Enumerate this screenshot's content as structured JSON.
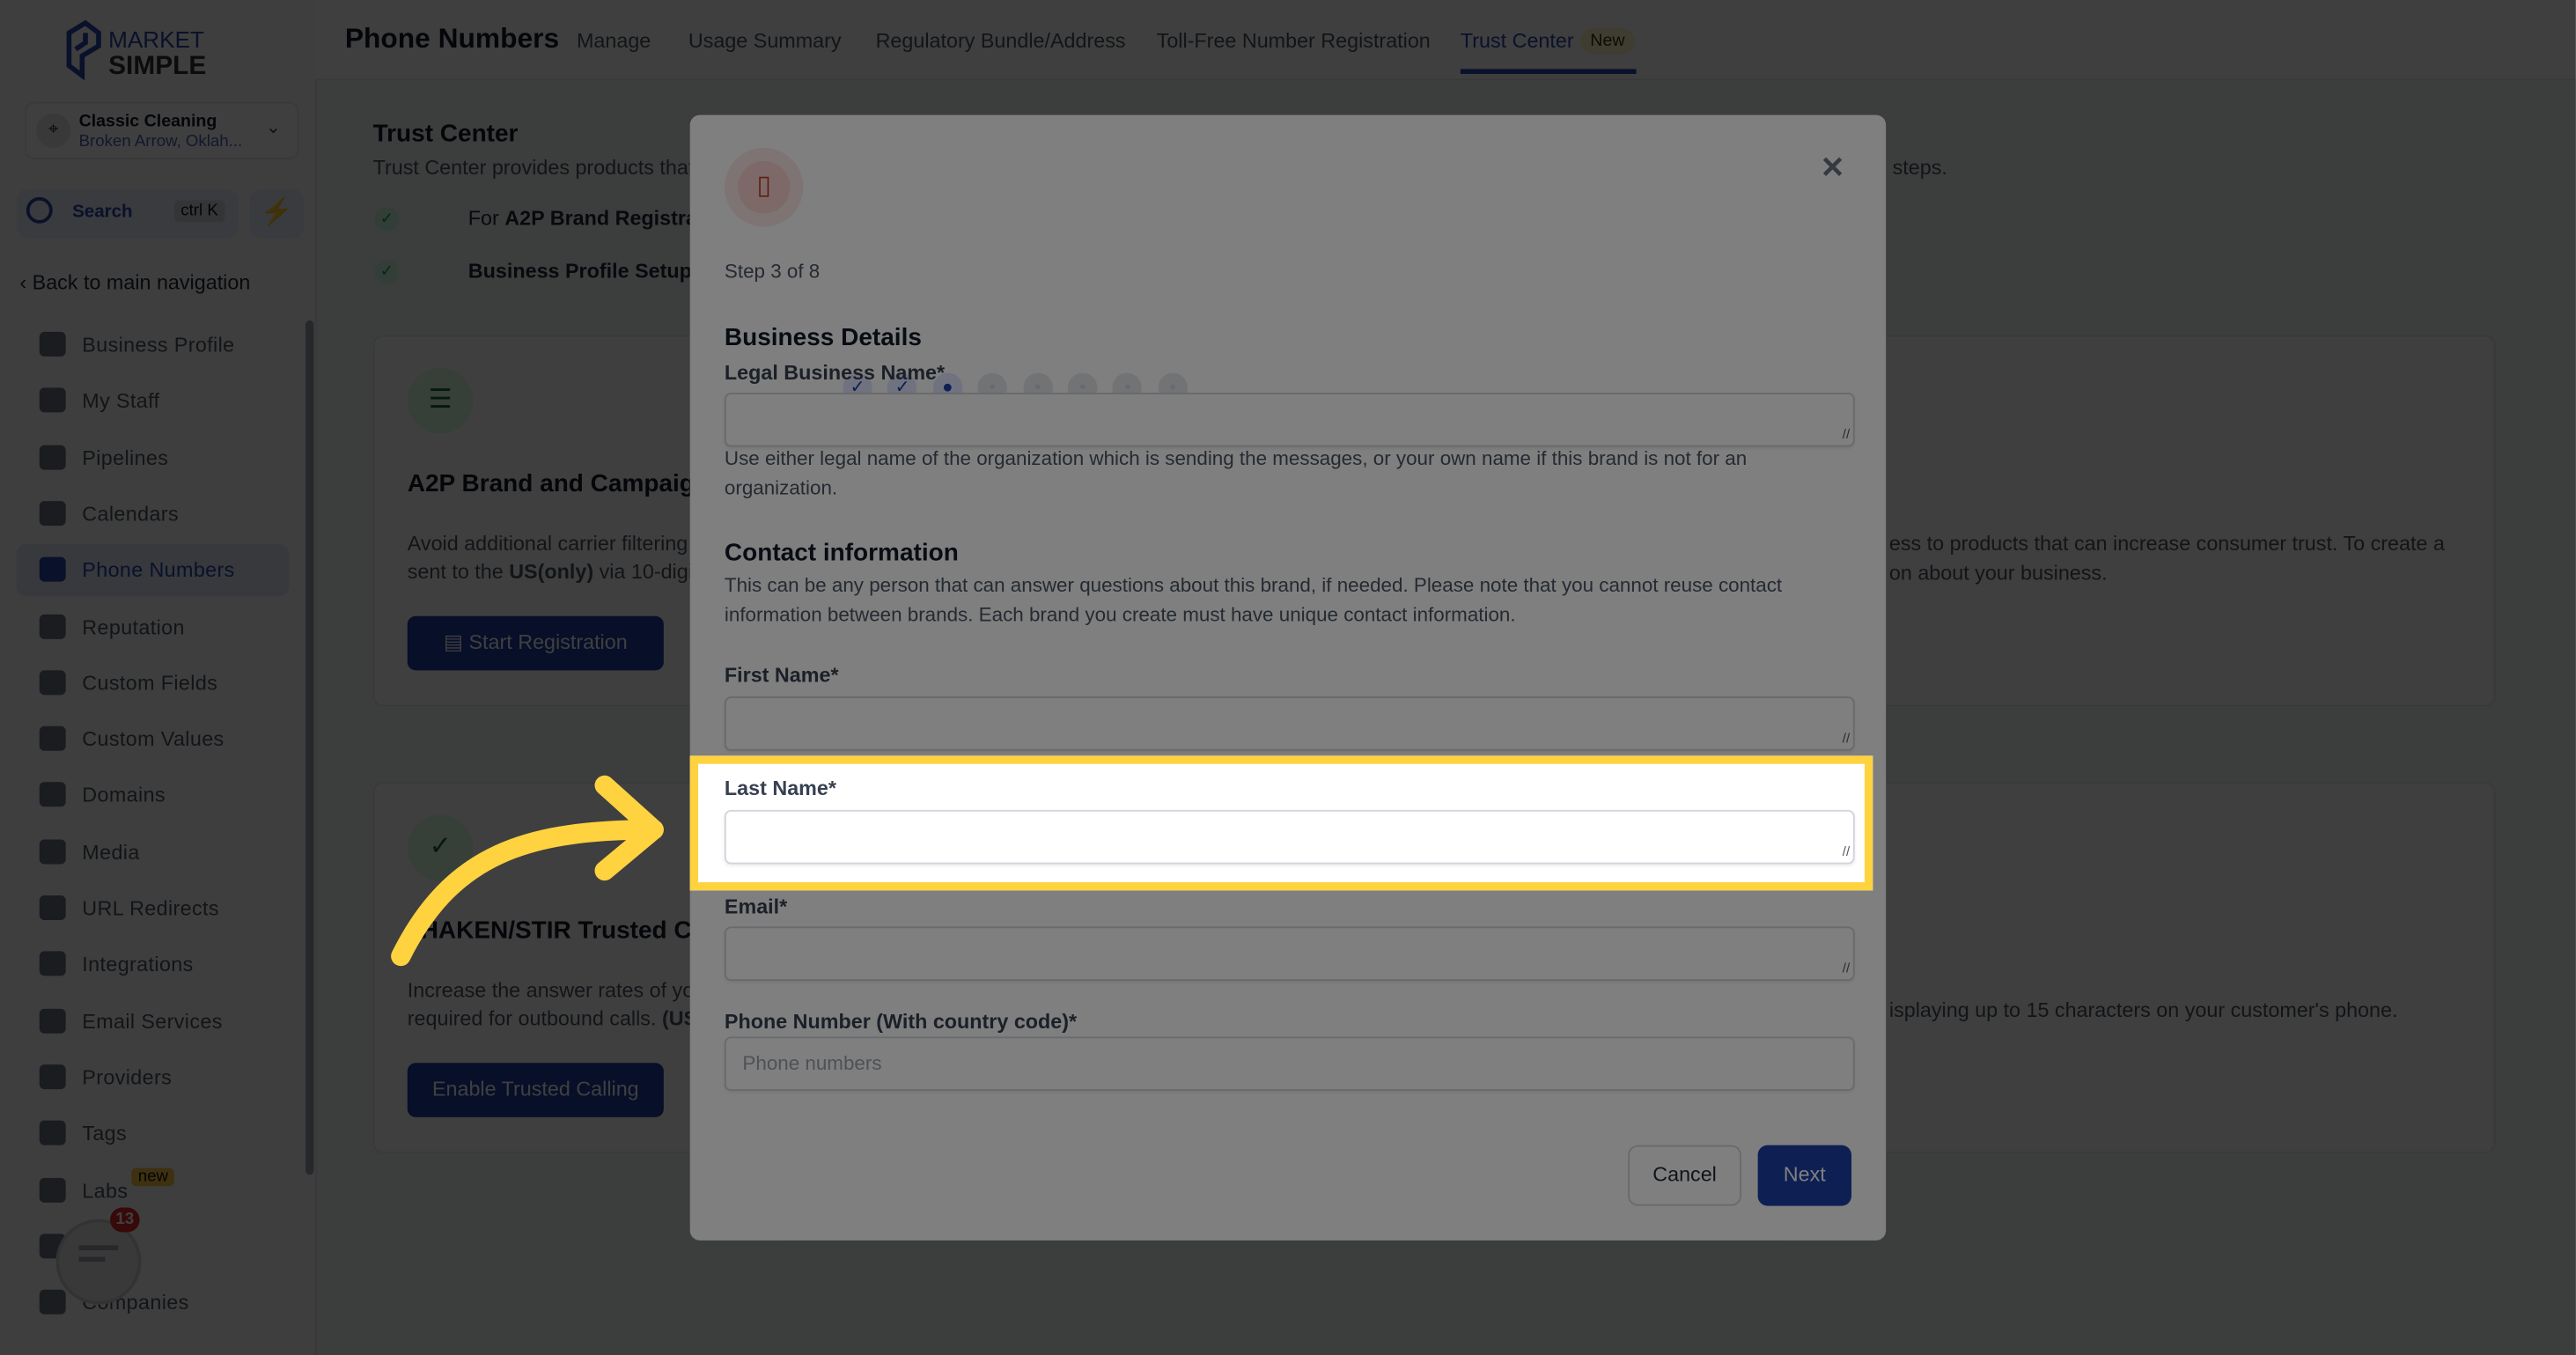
{
  "brand": {
    "logo_top": "MARKET",
    "logo_bottom": "SIMPLE"
  },
  "location": {
    "name": "Classic Cleaning",
    "address": "Broken Arrow, Oklah..."
  },
  "search": {
    "label": "Search",
    "shortcut": "ctrl K"
  },
  "sidebar": {
    "back": "Back to main navigation",
    "items": [
      {
        "label": "Business Profile",
        "icon": "briefcase-icon"
      },
      {
        "label": "My Staff",
        "icon": "user-icon"
      },
      {
        "label": "Pipelines",
        "icon": "funnel-icon"
      },
      {
        "label": "Calendars",
        "icon": "calendar-icon"
      },
      {
        "label": "Phone Numbers",
        "icon": "phone-icon",
        "active": true
      },
      {
        "label": "Reputation",
        "icon": "star-icon"
      },
      {
        "label": "Custom Fields",
        "icon": "fields-icon"
      },
      {
        "label": "Custom Values",
        "icon": "diamond-icon"
      },
      {
        "label": "Domains",
        "icon": "globe-icon"
      },
      {
        "label": "Media",
        "icon": "video-icon"
      },
      {
        "label": "URL Redirects",
        "icon": "redirect-icon"
      },
      {
        "label": "Integrations",
        "icon": "integrations-icon"
      },
      {
        "label": "Email Services",
        "icon": "mail-icon"
      },
      {
        "label": "Providers",
        "icon": "clipboard-icon"
      },
      {
        "label": "Tags",
        "icon": "tag-icon"
      },
      {
        "label": "Labs",
        "icon": "flask-icon"
      },
      {
        "label": "Logs",
        "icon": "bar-chart-icon"
      },
      {
        "label": "Companies",
        "icon": "building-icon"
      }
    ],
    "labs_badge": "new"
  },
  "chat": {
    "badge": "13"
  },
  "header": {
    "title": "Phone Numbers",
    "tabs": [
      {
        "label": "Manage"
      },
      {
        "label": "Usage Summary"
      },
      {
        "label": "Regulatory Bundle/Address"
      },
      {
        "label": "Toll-Free Number Registration"
      },
      {
        "label": "Trust Center",
        "active": true
      }
    ],
    "tab_badge": "New"
  },
  "content": {
    "title": "Trust Center",
    "desc": "Trust Center provides products that c",
    "desc_tail": "steps.",
    "checks": [
      {
        "prefix": "For ",
        "bold": "A2P Brand Registratio"
      },
      {
        "prefix": "",
        "bold": "Business Profile Setup",
        "suffix": " w"
      }
    ],
    "card1": {
      "title": "A2P Brand and Campaign",
      "line1": "Avoid additional carrier filtering b",
      "line2_pre": "sent to the ",
      "line2_bold": "US(only)",
      "line2_post": " via 10-digit l",
      "button": "Start Registration",
      "tail1": "ess to products that can increase consumer trust. To create a",
      "tail2": "on about your business."
    },
    "card2": {
      "title": "HAKEN/STIR Trusted Ca",
      "line1": "Increase the answer rates of you",
      "line2_pre": "required for outbound calls. ",
      "line2_bold": "(US",
      "button": "Enable Trusted Calling",
      "tail1": "isplaying up to 15 characters on your customer's phone."
    }
  },
  "modal": {
    "step": "Step 3 of 8",
    "steps_total": 8,
    "steps_done": 2,
    "step_current": 3,
    "business_heading": "Business Details",
    "legal_label": "Legal Business Name*",
    "legal_value": "",
    "legal_help": "Use either legal name of the organization which is sending the messages, or your own name if this brand is not for an organization.",
    "contact_heading": "Contact information",
    "contact_desc": "This can be any person that can answer questions about this brand, if needed. Please note that you cannot reuse contact information between brands. Each brand you create must have unique contact information.",
    "first_label": "First Name*",
    "first_value": "",
    "last_label": "Last Name*",
    "last_value": "",
    "email_label": "Email*",
    "email_value": "",
    "phone_label": "Phone Number (With country code)*",
    "phone_placeholder": "Phone numbers",
    "cancel": "Cancel",
    "next": "Next"
  },
  "colors": {
    "accent": "#1d3fa6",
    "highlight": "#ffd240",
    "modal_icon": "#c0392b"
  }
}
